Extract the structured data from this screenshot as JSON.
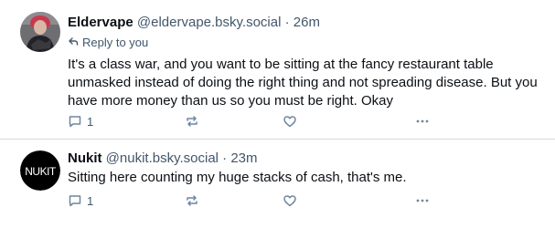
{
  "posts": [
    {
      "author": "Eldervape",
      "handle": "@eldervape.bsky.social",
      "separator": "·",
      "time": "26m",
      "reply_to": "Reply to you",
      "text": "It's a class war, and you want to be sitting at the fancy restaurant table unmasked instead of doing the right thing and not spreading disease. But you have more money than us so you must be right. Okay",
      "reply_count": "1",
      "avatar_icon": "person-photo-avatar"
    },
    {
      "author": "Nukit",
      "handle": "@nukit.bsky.social",
      "separator": "·",
      "time": "23m",
      "text": "Sitting here counting my huge stacks of cash, that's me.",
      "reply_count": "1",
      "avatar_logo_text": "NUKIT"
    }
  ],
  "colors": {
    "text": "#0b0f14",
    "muted": "#42576c",
    "icon": "#6f869f",
    "divider": "#d4dbe2"
  }
}
